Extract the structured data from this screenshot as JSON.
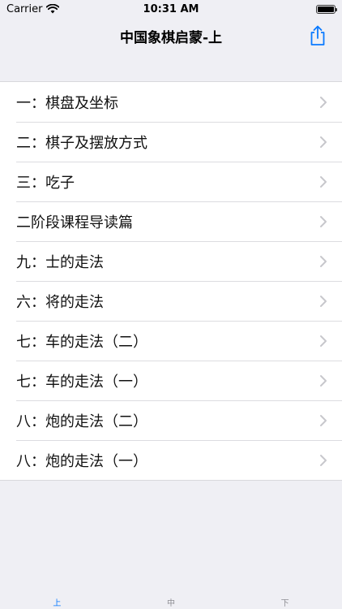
{
  "status": {
    "carrier": "Carrier",
    "time": "10:31 AM"
  },
  "nav": {
    "title": "中国象棋启蒙-上",
    "share_icon": "share-icon"
  },
  "lessons": [
    {
      "label": "一：棋盘及坐标"
    },
    {
      "label": "二：棋子及摆放方式"
    },
    {
      "label": "三：吃子"
    },
    {
      "label": "二阶段课程导读篇"
    },
    {
      "label": "九：士的走法"
    },
    {
      "label": "六：将的走法"
    },
    {
      "label": "七：车的走法（二）"
    },
    {
      "label": "七：车的走法（一）"
    },
    {
      "label": "八：炮的走法（二）"
    },
    {
      "label": "八：炮的走法（一）"
    }
  ],
  "tabs": [
    {
      "label": "上",
      "active": true
    },
    {
      "label": "中",
      "active": false
    },
    {
      "label": "下",
      "active": false
    }
  ],
  "colors": {
    "accent": "#0a7aff",
    "background": "#efeff4",
    "chevron": "#c7c7cc"
  }
}
